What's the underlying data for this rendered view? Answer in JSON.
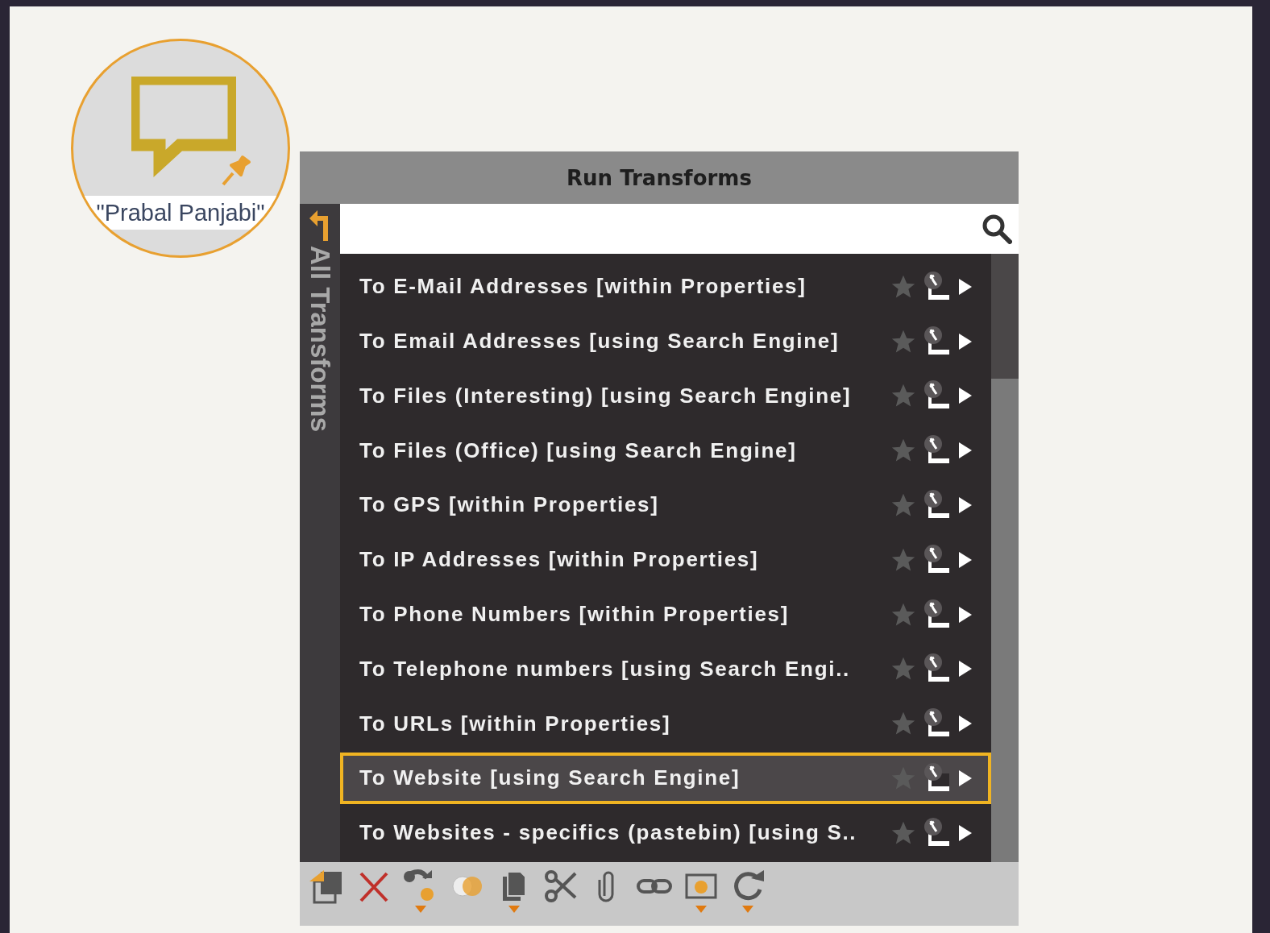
{
  "entity": {
    "label": "\"Prabal Panjabi\""
  },
  "panel": {
    "title": "Run Transforms",
    "side_tab": "All Transforms"
  },
  "transforms": [
    {
      "label": "To E-Mail Addresses [within Properties]",
      "selected": false
    },
    {
      "label": "To Email Addresses [using Search Engine]",
      "selected": false
    },
    {
      "label": "To Files (Interesting) [using Search Engine]",
      "selected": false
    },
    {
      "label": "To Files (Office) [using Search Engine]",
      "selected": false
    },
    {
      "label": "To GPS [within Properties]",
      "selected": false
    },
    {
      "label": "To IP Addresses [within Properties]",
      "selected": false
    },
    {
      "label": "To Phone Numbers [within Properties]",
      "selected": false
    },
    {
      "label": "To Telephone numbers [using Search Engi..",
      "selected": false
    },
    {
      "label": "To URLs [within Properties]",
      "selected": false
    },
    {
      "label": "To Website [using Search Engine]",
      "selected": true
    },
    {
      "label": "To Websites - specifics (pastebin) [using S..",
      "selected": false
    }
  ],
  "toolbar": [
    {
      "kind": "export",
      "menu": false
    },
    {
      "kind": "delete",
      "menu": false
    },
    {
      "kind": "transform",
      "menu": true
    },
    {
      "kind": "merge",
      "menu": false
    },
    {
      "kind": "copy",
      "menu": true
    },
    {
      "kind": "cut",
      "menu": false
    },
    {
      "kind": "attach",
      "menu": false
    },
    {
      "kind": "link",
      "menu": false
    },
    {
      "kind": "view",
      "menu": true
    },
    {
      "kind": "refresh",
      "menu": true
    }
  ]
}
